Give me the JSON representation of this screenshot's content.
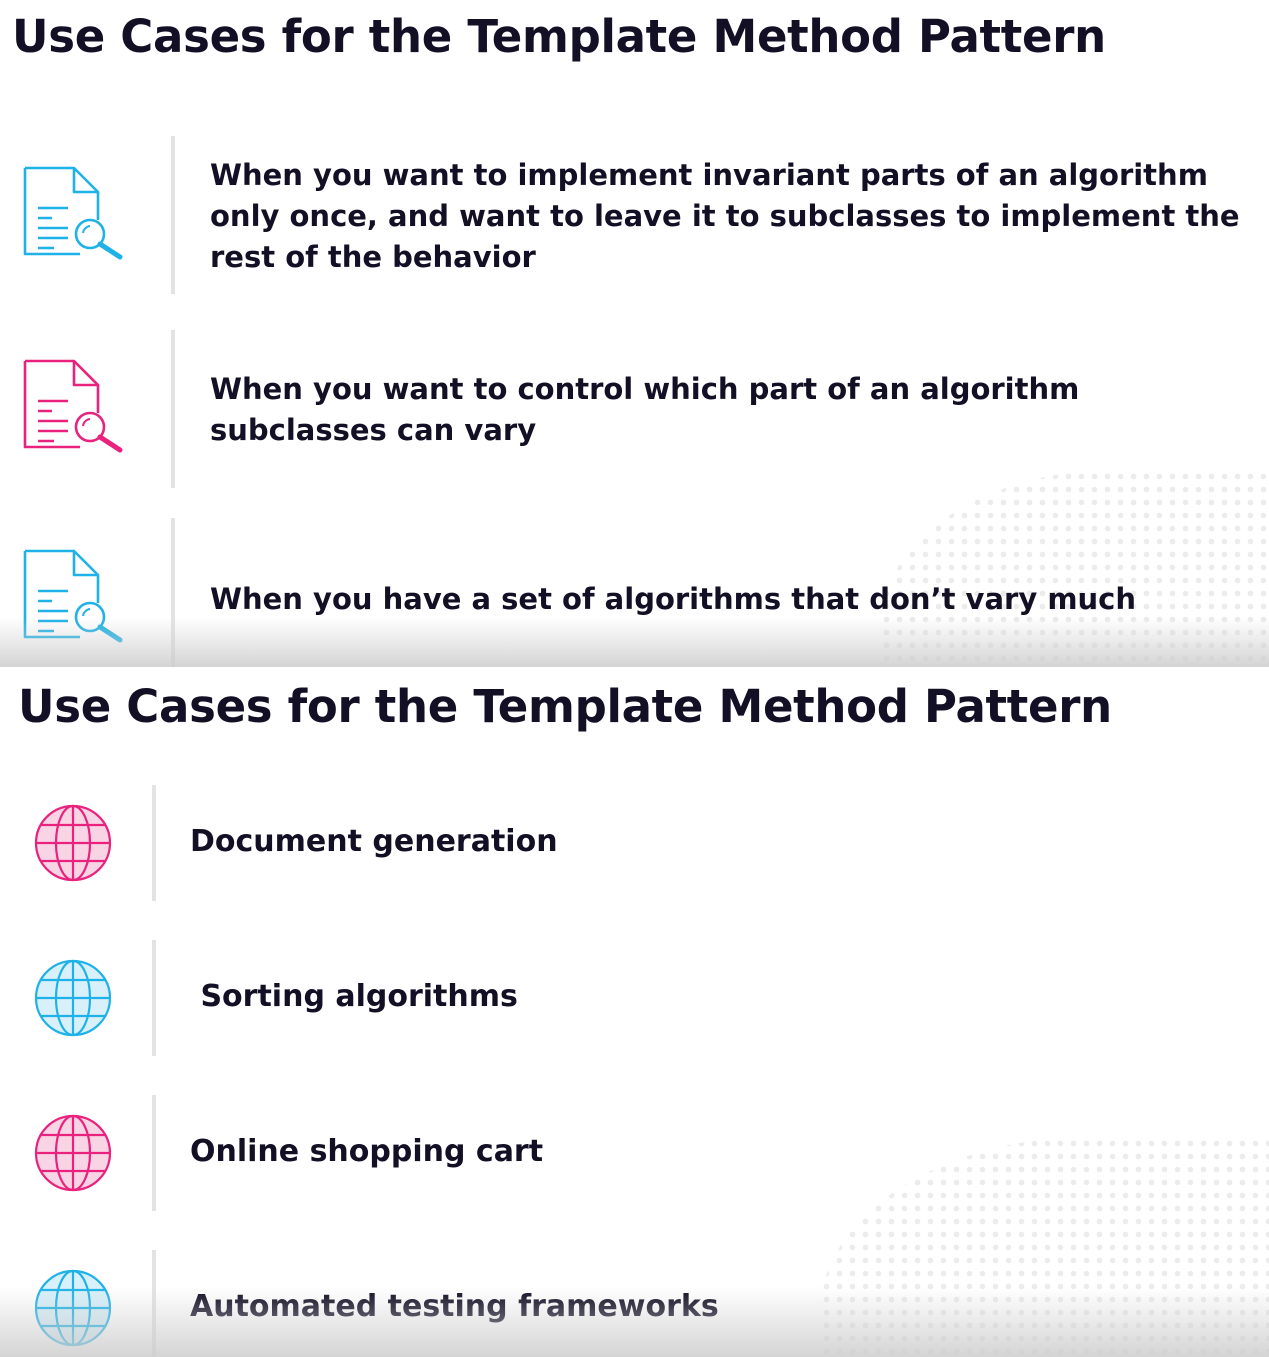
{
  "colors": {
    "text": "#130f25",
    "accent_blue": "#1fb2e8",
    "accent_pink": "#e8227d",
    "globe_blue_fill": "#d7f0fa",
    "globe_pink_fill": "#f9d4e4",
    "divider": "#e3e3e3"
  },
  "slides": [
    {
      "title": "Use Cases for the Template Method Pattern",
      "items": [
        {
          "icon": "document-search-icon",
          "color": "blue",
          "text": "When you want to implement invariant parts of an algorithm only once, and want to leave it to subclasses to implement the rest of the behavior"
        },
        {
          "icon": "document-search-icon",
          "color": "pink",
          "text": "When you want to control which part of an algorithm subclasses can vary"
        },
        {
          "icon": "document-search-icon",
          "color": "blue",
          "text": "When you have a set of algorithms that don’t vary much"
        }
      ]
    },
    {
      "title": "Use Cases for the Template Method Pattern",
      "items": [
        {
          "icon": "globe-icon",
          "color": "pink",
          "text": "Document generation"
        },
        {
          "icon": "globe-icon",
          "color": "blue",
          "text": " Sorting algorithms"
        },
        {
          "icon": "globe-icon",
          "color": "pink",
          "text": "Online shopping cart"
        },
        {
          "icon": "globe-icon",
          "color": "blue",
          "text": "Automated testing frameworks"
        }
      ]
    }
  ]
}
